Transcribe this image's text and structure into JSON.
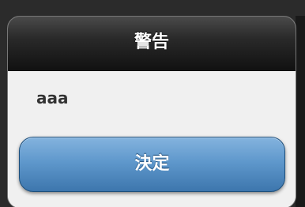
{
  "dialog": {
    "title": "警告",
    "message": "aaa",
    "confirm_label": "決定"
  },
  "colors": {
    "background": "#2b2b2b",
    "header": "#111111",
    "body": "#f0f0f0",
    "button": "#5f98cc",
    "button_text": "#ffffff"
  }
}
